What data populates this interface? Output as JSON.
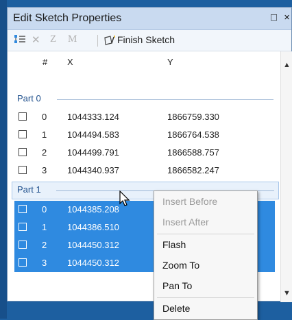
{
  "window": {
    "title": "Edit Sketch Properties",
    "maximize_glyph": "□",
    "close_glyph": "×"
  },
  "toolbar": {
    "z_label": "Z",
    "m_label": "M",
    "delete_glyph": "✕",
    "finish_label": "Finish Sketch"
  },
  "columns": {
    "index": "#",
    "x": "X",
    "y": "Y"
  },
  "parts": [
    {
      "label": "Part 0",
      "rows": [
        {
          "index": "0",
          "x": "1044333.124",
          "y": "1866759.330"
        },
        {
          "index": "1",
          "x": "1044494.583",
          "y": "1866764.538"
        },
        {
          "index": "2",
          "x": "1044499.791",
          "y": "1866588.757"
        },
        {
          "index": "3",
          "x": "1044340.937",
          "y": "1866582.247"
        }
      ]
    },
    {
      "label": "Part 1",
      "rows": [
        {
          "index": "0",
          "x": "1044385.208",
          "y": ""
        },
        {
          "index": "1",
          "x": "1044386.510",
          "y": ""
        },
        {
          "index": "2",
          "x": "1044450.312",
          "y": ""
        },
        {
          "index": "3",
          "x": "1044450.312",
          "y": ""
        }
      ]
    }
  ],
  "context_menu": {
    "insert_before": "Insert Before",
    "insert_after": "Insert After",
    "flash": "Flash",
    "zoom_to": "Zoom To",
    "pan_to": "Pan To",
    "delete": "Delete"
  },
  "colors": {
    "selection": "#2f8ae0",
    "titlebar": "#c9daf0",
    "desktop": "#1d5fa0"
  }
}
